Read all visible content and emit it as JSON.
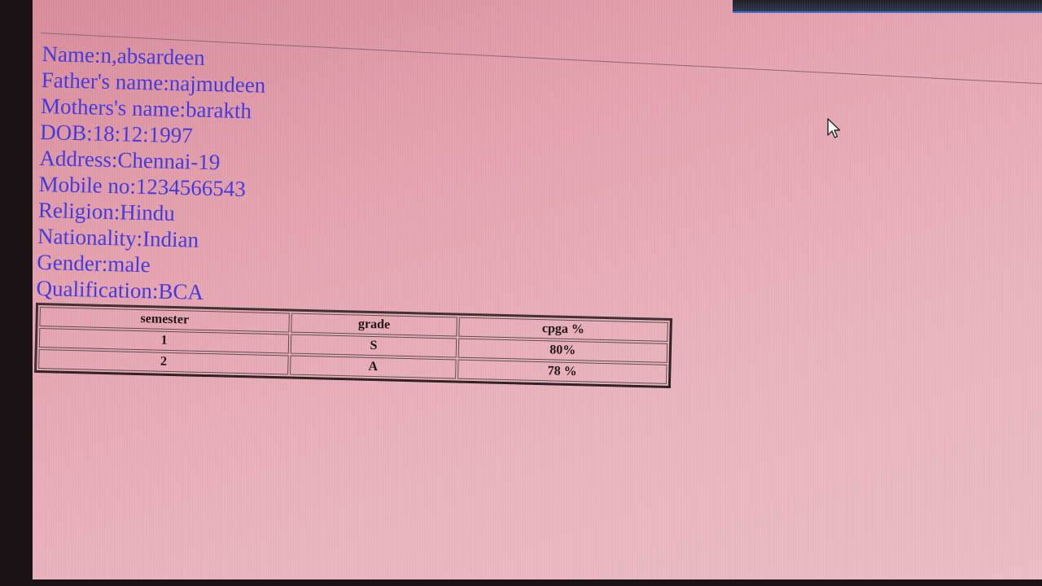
{
  "profile": {
    "name": "Name:n,absardeen",
    "father": "Father's name:najmudeen",
    "mother": "Mothers's name:barakth",
    "dob": "DOB:18:12:1997",
    "address": "Address:Chennai-19",
    "mobile": "Mobile no:1234566543",
    "religion": "Religion:Hindu",
    "nationality": "Nationality:Indian",
    "gender": "Gender:male",
    "qualification": "Qualification:BCA"
  },
  "marks_table": {
    "headers": [
      "semester",
      "grade",
      "cpga %"
    ],
    "rows": [
      [
        "1",
        "S",
        "80%"
      ],
      [
        "2",
        "A",
        "78 %"
      ]
    ]
  },
  "colors": {
    "page_background": "#e6a4b0",
    "field_text": "#3f35e0",
    "table_text": "#1a1012"
  },
  "icons": {
    "cursor": "mouse-pointer-icon"
  }
}
